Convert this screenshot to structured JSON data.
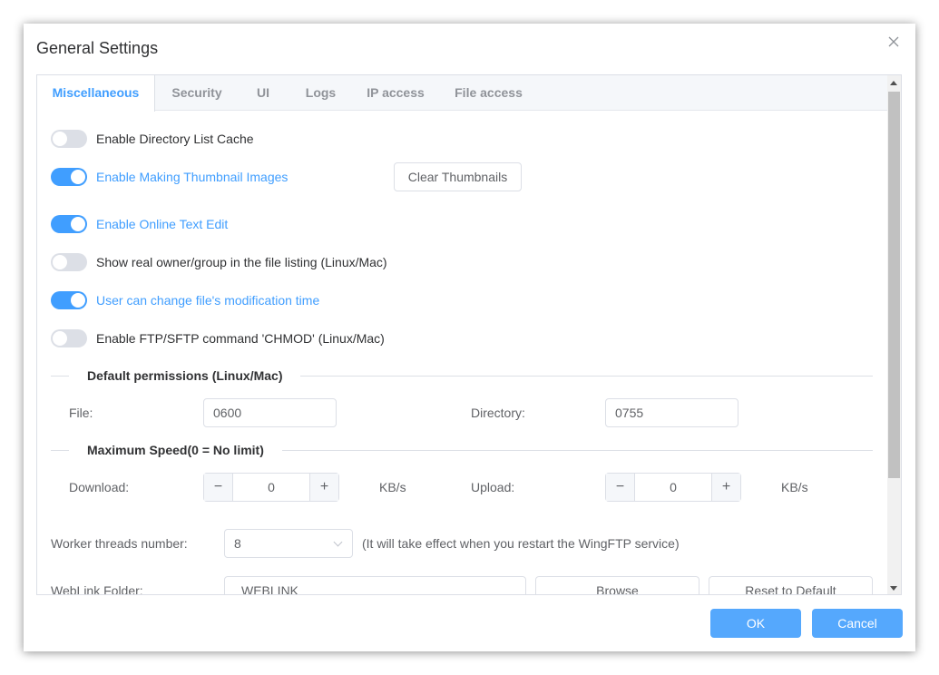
{
  "dialog": {
    "title": "General Settings",
    "close_icon": "close-icon"
  },
  "tabs": [
    {
      "label": "Miscellaneous",
      "active": true
    },
    {
      "label": "Security",
      "active": false
    },
    {
      "label": "UI",
      "active": false
    },
    {
      "label": "Logs",
      "active": false
    },
    {
      "label": "IP access",
      "active": false
    },
    {
      "label": "File access",
      "active": false
    }
  ],
  "toggles": [
    {
      "label": "Enable Directory List Cache",
      "on": false
    },
    {
      "label": "Enable Making Thumbnail Images",
      "on": true
    },
    {
      "label": "Enable Online Text Edit",
      "on": true
    },
    {
      "label": "Show real owner/group in the file listing (Linux/Mac)",
      "on": false
    },
    {
      "label": "User can change file's modification time",
      "on": true
    },
    {
      "label": "Enable FTP/SFTP command 'CHMOD' (Linux/Mac)",
      "on": false
    }
  ],
  "clear_thumbnails_label": "Clear Thumbnails",
  "permissions": {
    "section_title": "Default permissions (Linux/Mac)",
    "file_label": "File:",
    "file_value": "0600",
    "directory_label": "Directory:",
    "directory_value": "0755"
  },
  "speed": {
    "section_title": "Maximum Speed(0 = No limit)",
    "download_label": "Download:",
    "download_value": "0",
    "upload_label": "Upload:",
    "upload_value": "0",
    "unit": "KB/s",
    "minus": "−",
    "plus": "+"
  },
  "worker": {
    "label": "Worker threads number:",
    "value": "8",
    "note": "(It will take effect when you restart the WingFTP service)"
  },
  "weblink": {
    "label": "WebLink Folder:",
    "value": "WEBLINK",
    "browse_label": "Browse",
    "reset_label": "Reset to Default"
  },
  "footer": {
    "ok_label": "OK",
    "cancel_label": "Cancel"
  },
  "colors": {
    "accent": "#409eff",
    "footer_button": "#55a8fd"
  }
}
